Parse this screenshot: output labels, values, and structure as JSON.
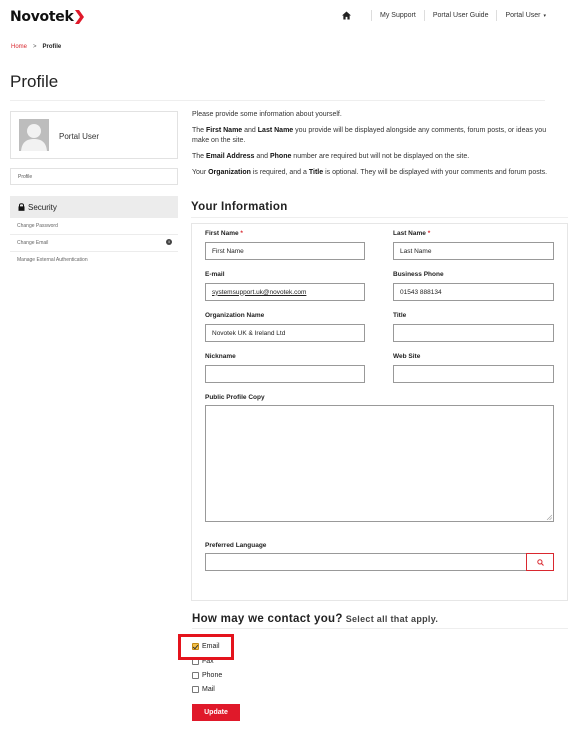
{
  "header": {
    "brand": "Novotek",
    "nav": {
      "home_icon": "home-icon",
      "my_support": "My Support",
      "portal_user_guide": "Portal User Guide",
      "portal_user": "Portal User",
      "caret": "▾"
    },
    "accent_color": "#e0192a"
  },
  "breadcrumb": {
    "home": "Home",
    "separator": ">",
    "current": "Profile"
  },
  "page_title": "Profile",
  "sidebar": {
    "user_name": "Portal User",
    "profile_link": "Profile",
    "security_label": "Security",
    "items": [
      {
        "label": "Change Password"
      },
      {
        "label": "Change Email",
        "icon": "info-icon"
      },
      {
        "label": "Manage External Authentication"
      }
    ]
  },
  "intro": {
    "p1": "Please provide some information about yourself.",
    "p2": {
      "a": "The ",
      "b": "First Name",
      "c": " and ",
      "d": "Last Name",
      "e": " you provide will be displayed alongside any comments, forum posts, or ideas you make on the site."
    },
    "p3": {
      "a": "The ",
      "b": "Email Address",
      "c": " and ",
      "d": "Phone",
      "e": " number are required but will not be displayed on the site."
    },
    "p4": {
      "a": "Your ",
      "b": "Organization",
      "c": " is required, and a ",
      "d": "Title",
      "e": " is optional. They will be displayed with your comments and forum posts."
    }
  },
  "form": {
    "section_title": "Your Information",
    "first_name": {
      "label": "First Name",
      "required": "*",
      "value": "First Name"
    },
    "last_name": {
      "label": "Last Name",
      "required": "*",
      "value": "Last Name"
    },
    "email": {
      "label": "E-mail",
      "value": "systemsupport.uk@novotek.com"
    },
    "business_phone": {
      "label": "Business Phone",
      "value": "01543 888134"
    },
    "organization": {
      "label": "Organization Name",
      "value": "Novotek UK & Ireland Ltd"
    },
    "title": {
      "label": "Title",
      "value": ""
    },
    "nickname": {
      "label": "Nickname",
      "value": ""
    },
    "website": {
      "label": "Web Site",
      "value": ""
    },
    "public_profile": {
      "label": "Public Profile Copy",
      "value": ""
    },
    "preferred_language": {
      "label": "Preferred Language",
      "value": ""
    }
  },
  "contact": {
    "title": "How may we contact you?",
    "subtitle": "Select all that apply.",
    "options": [
      {
        "label": "Email",
        "checked": true
      },
      {
        "label": "Fax",
        "checked": false
      },
      {
        "label": "Phone",
        "checked": false
      },
      {
        "label": "Mail",
        "checked": false
      }
    ]
  },
  "update_label": "Update"
}
